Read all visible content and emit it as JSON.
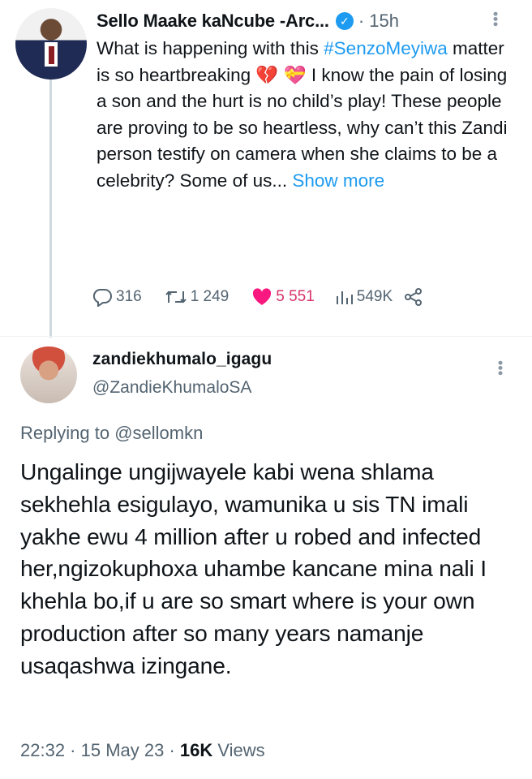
{
  "tweet1": {
    "author_name": "Sello Maake kaNcube -Arc...",
    "time": "· 15h",
    "text_intro": "What is happening with this ",
    "hashtag": "#SenzoMeyiwa",
    "text_body": " matter is so heartbreaking 💔 💝 I know the pain of losing a son and the hurt is no child’s play! These people are proving to be so heartless, why can’t this Zandi person testify on camera when she claims to be a celebrity? Some of us... ",
    "show_more": "Show more",
    "actions": {
      "replies": "316",
      "retweets": "1 249",
      "likes": "5 551",
      "views": "549K"
    },
    "icons": [
      "reply-icon",
      "retweet-icon",
      "heart-icon",
      "analytics-icon",
      "share-icon",
      "more-icon",
      "verified-badge-icon"
    ],
    "accent_color": "#1d9bf0",
    "like_color": "#f91880"
  },
  "tweet2": {
    "display_name": "zandiekhumalo_igagu",
    "handle": "@ZandieKhumaloSA",
    "replying_label": "Replying to",
    "replying_to": "@sellomkn",
    "text": "Ungalinge ungijwayele kabi wena shlama sekhehla esigulayo, wamunika u sis TN imali yakhe ewu 4 million after u robed and infected her,ngizokuphoxa uhambe kancane mina nali I khehla bo,if u are so smart where is your own production after so many years namanje usaqashwa izingane.",
    "timestamp": "22:32 · 15 May 23 · ",
    "views_count": "16K",
    "views_label": " Views"
  }
}
